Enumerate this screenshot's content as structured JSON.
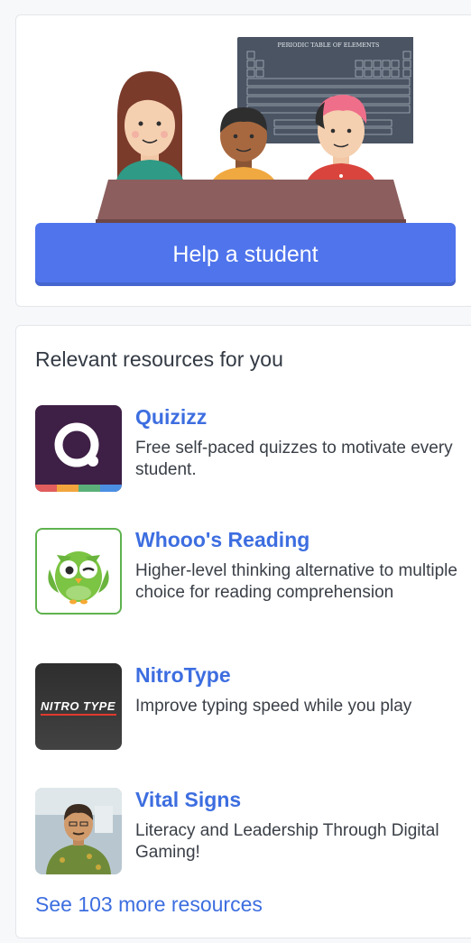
{
  "help_card": {
    "illustration_label": "PERIODIC TABLE OF ELEMENTS",
    "button_label": "Help a student"
  },
  "resources": {
    "title": "Relevant resources for you",
    "items": [
      {
        "name": "Quizizz",
        "description": "Free self-paced quizzes to motivate every student.",
        "icon": "quizizz-logo"
      },
      {
        "name": "Whooo's Reading",
        "description": "Higher-level thinking alternative to multiple choice for reading comprehension",
        "icon": "owl-logo"
      },
      {
        "name": "NitroType",
        "description": "Improve typing speed while you play",
        "icon": "nitrotype-logo",
        "logo_text": "NITRO TYPE"
      },
      {
        "name": "Vital Signs",
        "description": "Literacy and Leadership Through Digital Gaming!",
        "icon": "avatar-thumbnail"
      }
    ],
    "see_more": "See 103 more resources"
  },
  "colors": {
    "accent": "#4f74ec",
    "link": "#3d6ee0"
  }
}
